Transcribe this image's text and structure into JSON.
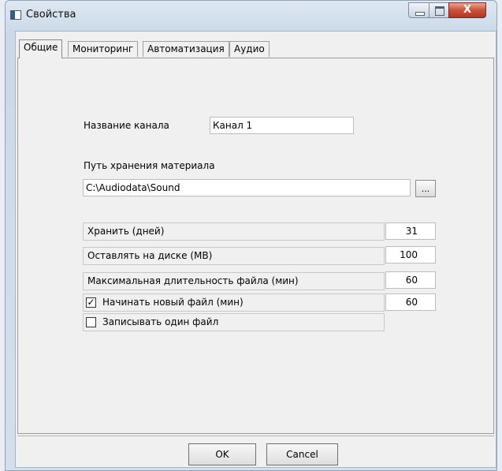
{
  "window": {
    "title": "Свойства",
    "icons": {
      "app": "window-app-icon",
      "minimize": "minimize-icon",
      "maximize": "maximize-icon",
      "close": "close-icon"
    },
    "close_glyph": "X"
  },
  "tabs": [
    {
      "label": "Общие",
      "active": true
    },
    {
      "label": "Мониторинг",
      "active": false
    },
    {
      "label": "Автоматизация",
      "active": false
    },
    {
      "label": "Аудио",
      "active": false
    }
  ],
  "general": {
    "channel_name_label": "Название канала",
    "channel_name_value": "Канал 1",
    "storage_path_label": "Путь хранения материала",
    "storage_path_value": "C:\\Audiodata\\Sound",
    "browse_label": "...",
    "keep_days_label": "Хранить (дней)",
    "keep_days_value": "31",
    "leave_on_disk_label": "Оставлять на диске (MB)",
    "leave_on_disk_value": "100",
    "max_file_duration_label": "Максимальная длительность файла (мин)",
    "max_file_duration_value": "60",
    "start_new_file_label": "Начинать новый файл (мин)",
    "start_new_file_checked": true,
    "start_new_file_checkmark": "✓",
    "start_new_file_value": "60",
    "record_single_file_label": "Записывать один файл",
    "record_single_file_checked": false
  },
  "buttons": {
    "ok": "OK",
    "cancel": "Cancel"
  }
}
